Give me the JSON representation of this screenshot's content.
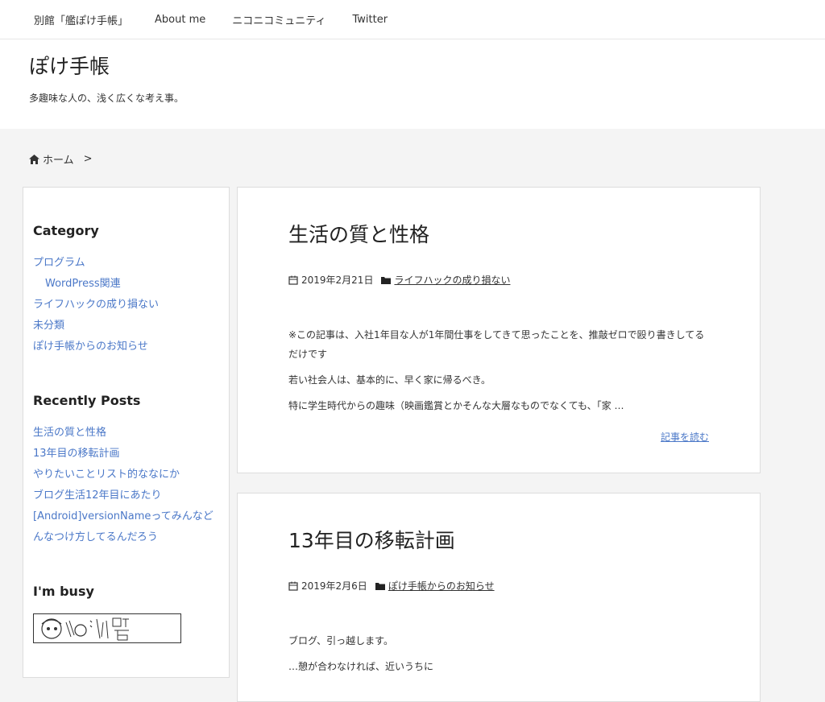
{
  "topnav": {
    "items": [
      "別館「艦ぽけ手帳」",
      "About me",
      "ニコニコミュニティ",
      "Twitter"
    ]
  },
  "header": {
    "title": "ぽけ手帳",
    "description": "多趣味な人の、浅く広くな考え事。"
  },
  "breadcrumb": {
    "home": "ホーム",
    "separator": ">"
  },
  "sidebar": {
    "category_title": "Category",
    "categories": [
      {
        "label": "プログラム",
        "child": false
      },
      {
        "label": "WordPress関連",
        "child": true
      },
      {
        "label": "ライフハックの成り損ない",
        "child": false
      },
      {
        "label": "未分類",
        "child": false
      },
      {
        "label": "ぽけ手帳からのお知らせ",
        "child": false
      }
    ],
    "recent_title": "Recently Posts",
    "recent": [
      "生活の質と性格",
      "13年目の移転計画",
      "やりたいことリスト的ななにか",
      "ブログ生活12年目にあたり",
      "[Android]versionNameってみんなどんなつけ方してるんだろう"
    ],
    "busy_title": "I'm busy"
  },
  "posts": [
    {
      "title": "生活の質と性格",
      "date": "2019年2月21日",
      "category": "ライフハックの成り損ない",
      "excerpt": [
        "※この記事は、入社1年目な人が1年間仕事をしてきて思ったことを、推敲ゼロで殴り書きしてるだけです",
        "若い社会人は、基本的に、早く家に帰るべき。",
        "特に学生時代からの趣味（映画鑑賞とかそんな大層なものでなくても、「家 …"
      ],
      "readmore": "記事を読む"
    },
    {
      "title": "13年目の移転計画",
      "date": "2019年2月6日",
      "category": "ぽけ手帳からのお知らせ",
      "excerpt": [
        "ブログ、引っ越します。",
        "…憩が合わなければ、近いうちに"
      ]
    }
  ]
}
